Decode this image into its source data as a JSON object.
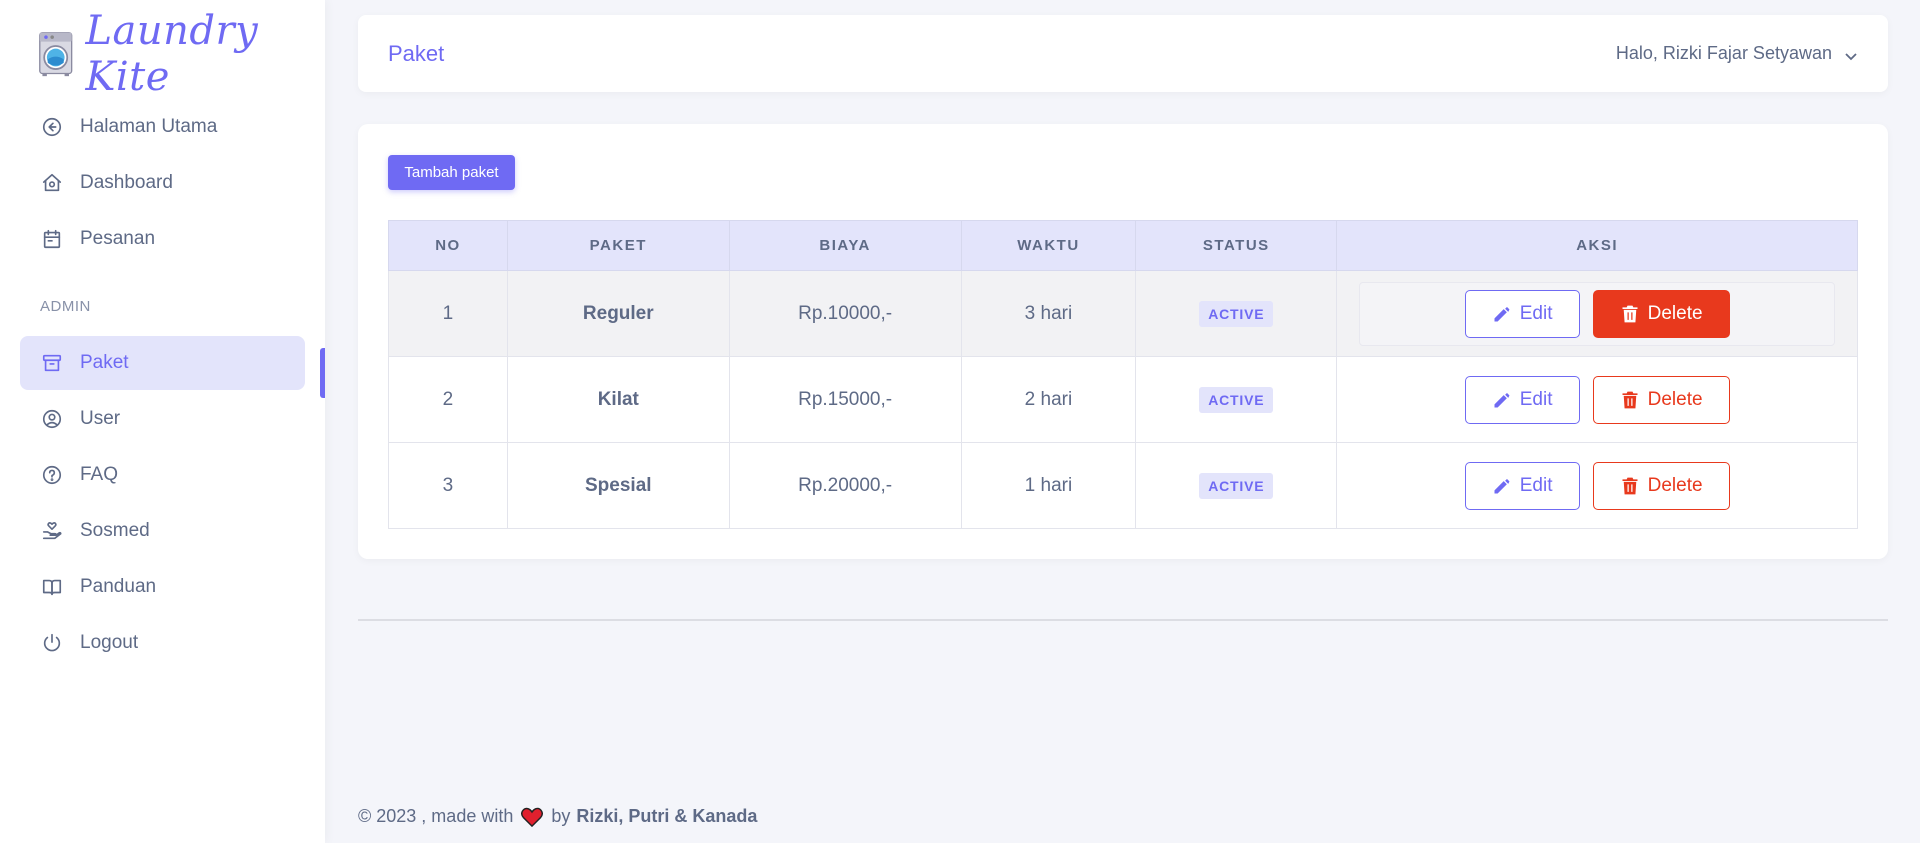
{
  "brand": {
    "name": "Laundry Kite"
  },
  "sidebar": {
    "items": [
      {
        "label": "Halaman Utama",
        "icon": "arrow-left-circle-icon"
      },
      {
        "label": "Dashboard",
        "icon": "home-icon"
      },
      {
        "label": "Pesanan",
        "icon": "calendar-icon"
      }
    ],
    "section_label": "ADMIN",
    "admin_items": [
      {
        "label": "Paket",
        "icon": "archive-icon",
        "active": true
      },
      {
        "label": "User",
        "icon": "user-circle-icon"
      },
      {
        "label": "FAQ",
        "icon": "question-circle-icon"
      },
      {
        "label": "Sosmed",
        "icon": "hand-heart-icon"
      },
      {
        "label": "Panduan",
        "icon": "book-open-icon"
      },
      {
        "label": "Logout",
        "icon": "power-icon"
      }
    ]
  },
  "header": {
    "title": "Paket",
    "user_greeting": "Halo, Rizki Fajar Setyawan"
  },
  "main": {
    "add_button_label": "Tambah paket",
    "table": {
      "columns": [
        "NO",
        "PAKET",
        "BIAYA",
        "WAKTU",
        "STATUS",
        "AKSI"
      ],
      "rows": [
        {
          "no": "1",
          "paket": "Reguler",
          "biaya": "Rp.10000,-",
          "waktu": "3 hari",
          "status": "ACTIVE"
        },
        {
          "no": "2",
          "paket": "Kilat",
          "biaya": "Rp.15000,-",
          "waktu": "2 hari",
          "status": "ACTIVE"
        },
        {
          "no": "3",
          "paket": "Spesial",
          "biaya": "Rp.20000,-",
          "waktu": "1 hari",
          "status": "ACTIVE"
        }
      ],
      "edit_label": "Edit",
      "delete_label": "Delete"
    }
  },
  "footer": {
    "prefix": "© 2023 , made with",
    "by": "by",
    "authors": "Rizki, Putri & Kanada"
  },
  "colors": {
    "accent": "#6f6af3",
    "danger": "#e8391d",
    "accent_light": "#e3e4fb"
  }
}
